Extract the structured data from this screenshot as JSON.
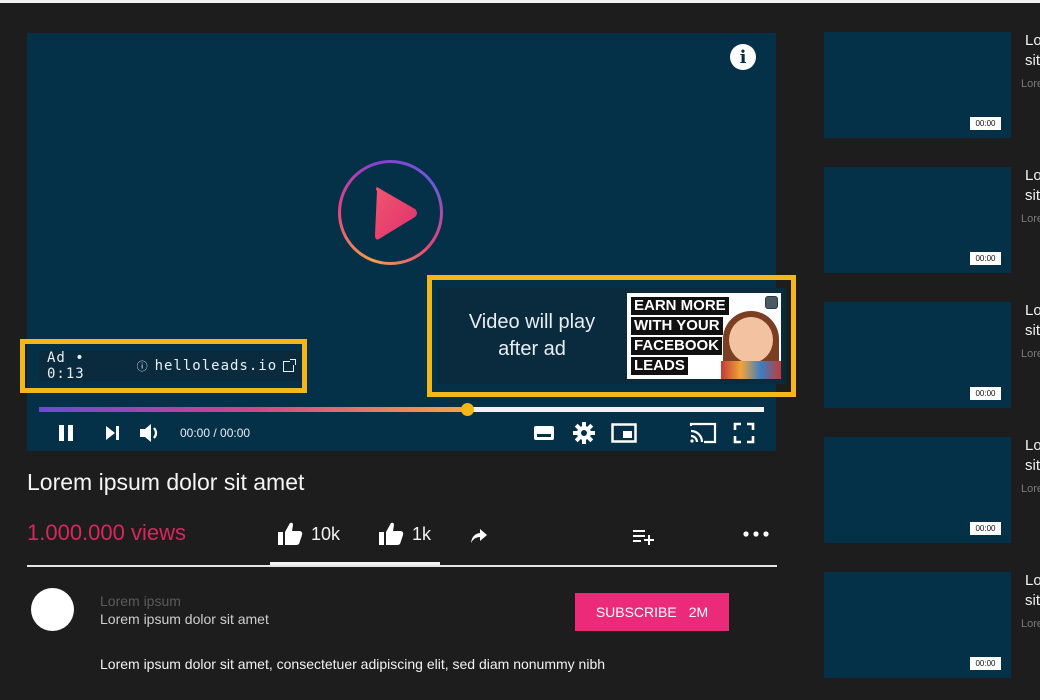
{
  "player": {
    "ad_label": "Ad • 0:13",
    "ad_domain": "helloleads.io",
    "preview_text_line1": "Video will play",
    "preview_text_line2": "after ad",
    "ad_image_lines": [
      "EARN MORE",
      "WITH YOUR",
      "FACEBOOK",
      "LEADS"
    ],
    "progress": 0.59,
    "time": "00:00 / 00:00"
  },
  "video": {
    "title": "Lorem ipsum dolor sit amet",
    "views": "1.000.000 views",
    "likes": "10k",
    "dislikes": "1k"
  },
  "channel": {
    "name": "Lorem ipsum",
    "subtitle": "Lorem ipsum dolor sit amet",
    "subscribe_label": "SUBSCRIBE",
    "subscriber_count": "2M"
  },
  "description": "Lorem ipsum dolor sit amet, consectetuer adipiscing elit, sed diam nonummy nibh",
  "sidebar": {
    "items": [
      {
        "title1": "Lo",
        "title2": "sit",
        "meta": "Lorem",
        "duration": "00:00"
      },
      {
        "title1": "Lo",
        "title2": "sit",
        "meta": "Lorem",
        "duration": "00:00"
      },
      {
        "title1": "Lo",
        "title2": "sit",
        "meta": "Lorem",
        "duration": "00:00"
      },
      {
        "title1": "Lo",
        "title2": "sit",
        "meta": "Lorem",
        "duration": "00:00"
      },
      {
        "title1": "Lo",
        "title2": "sit",
        "meta": "Lorem",
        "duration": "00:00"
      }
    ]
  },
  "colors": {
    "player_bg": "#053148",
    "highlight_border": "#f3b71b",
    "views_text": "#d8275f",
    "subscribe_bg": "#ec2a7a",
    "page_bg": "#1d1d1d"
  },
  "icons": [
    "info-icon",
    "play-icon",
    "external-link-icon",
    "pause-icon",
    "skip-next-icon",
    "volume-icon",
    "subtitles-icon",
    "gear-icon",
    "miniplayer-icon",
    "cast-icon",
    "fullscreen-icon",
    "thumbs-up-icon",
    "thumbs-up-icon",
    "share-icon",
    "add-to-playlist-icon",
    "more-icon"
  ]
}
